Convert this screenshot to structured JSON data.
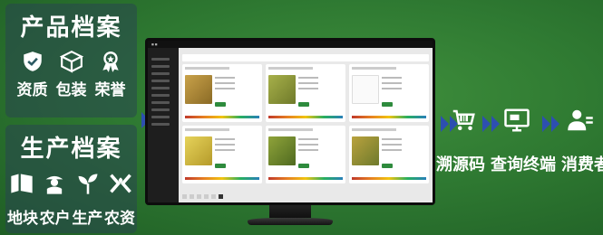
{
  "product_archive": {
    "title": "产品档案",
    "items": [
      {
        "label": "资质",
        "icon": "shield-check-icon"
      },
      {
        "label": "包装",
        "icon": "package-box-icon"
      },
      {
        "label": "荣誉",
        "icon": "award-medal-icon"
      }
    ]
  },
  "production_archive": {
    "title": "生产档案",
    "items": [
      {
        "label": "地块",
        "icon": "land-plot-icon"
      },
      {
        "label": "农户",
        "icon": "farmer-icon"
      },
      {
        "label": "生产",
        "icon": "sprout-icon"
      },
      {
        "label": "农资",
        "icon": "fertilizer-icon"
      }
    ]
  },
  "flow": [
    {
      "label": "溯源码",
      "icon": "scan-cart-icon"
    },
    {
      "label": "查询终端",
      "icon": "query-terminal-icon"
    },
    {
      "label": "消费者",
      "icon": "consumer-icon"
    }
  ],
  "colors": {
    "arrow": "#2d4fb0",
    "bg_green": "#2f7a32",
    "panel": "#284650"
  }
}
